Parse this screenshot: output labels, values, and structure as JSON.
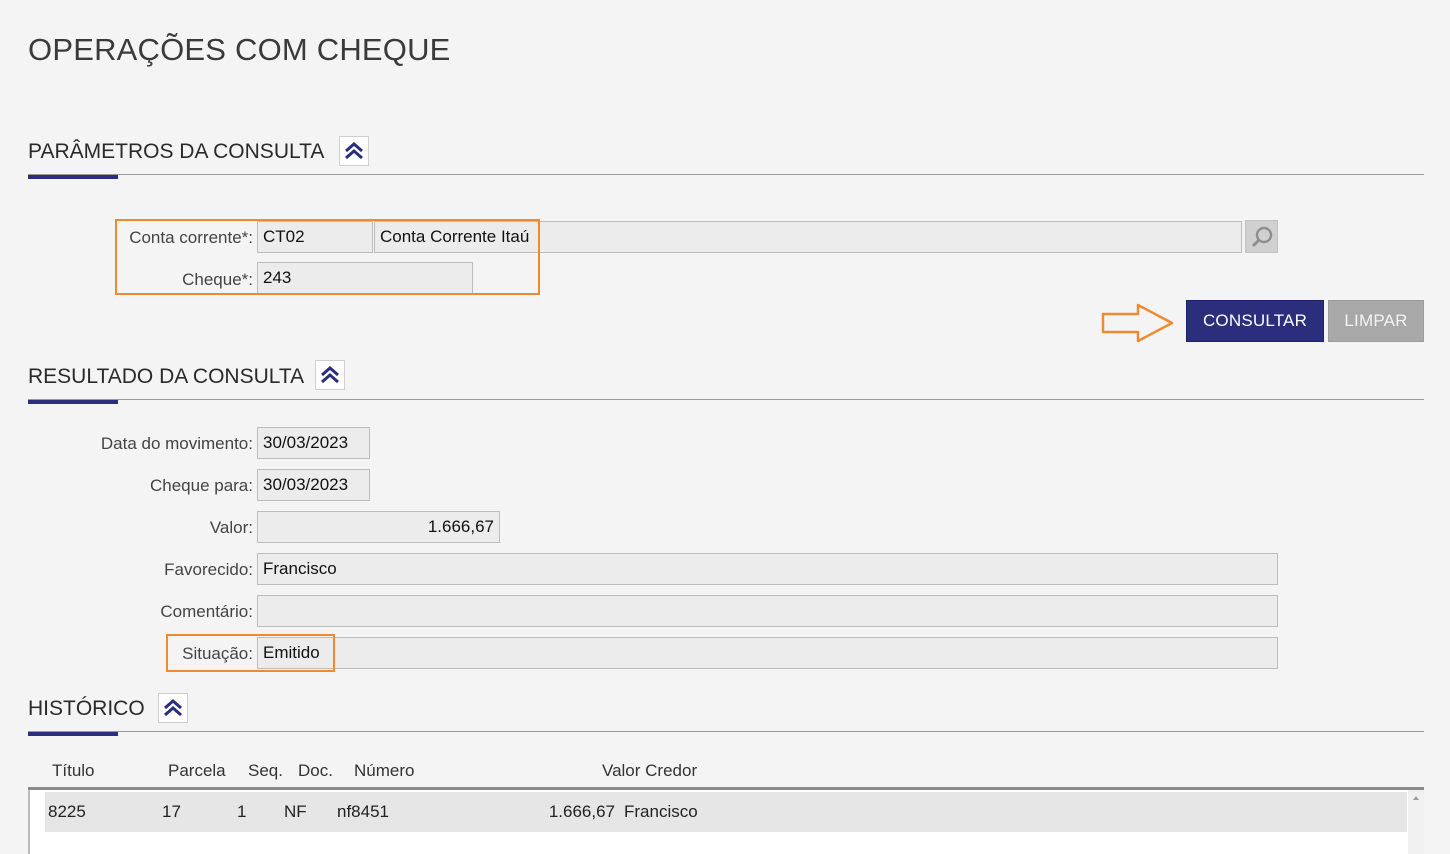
{
  "page": {
    "title": "OPERAÇÕES COM CHEQUE"
  },
  "params": {
    "title": "PARÂMETROS DA CONSULTA",
    "collapse_icon": "double-chevron-up-icon",
    "conta_label": "Conta corrente*:",
    "conta_code": "CT02",
    "conta_name": "Conta Corrente Itaú",
    "search_icon": "magnifier-icon",
    "cheque_label": "Cheque*:",
    "cheque_value": "243",
    "consultar_label": "CONSULTAR",
    "limpar_label": "LIMPAR",
    "arrow_icon": "arrow-right-outline-icon"
  },
  "result": {
    "title": "RESULTADO DA CONSULTA",
    "collapse_icon": "double-chevron-up-icon",
    "fields": {
      "data_movimento": {
        "label": "Data do movimento:",
        "value": "30/03/2023"
      },
      "cheque_para": {
        "label": "Cheque para:",
        "value": "30/03/2023"
      },
      "valor": {
        "label": "Valor:",
        "value": "1.666,67"
      },
      "favorecido": {
        "label": "Favorecido:",
        "value": "Francisco"
      },
      "comentario": {
        "label": "Comentário:",
        "value": ""
      },
      "situacao": {
        "label": "Situação:",
        "value": "Emitido"
      }
    }
  },
  "historico": {
    "title": "HISTÓRICO",
    "collapse_icon": "double-chevron-up-icon",
    "columns": [
      "Título",
      "Parcela",
      "Seq.",
      "Doc.",
      "Número",
      "Valor Credor"
    ],
    "rows": [
      {
        "titulo": "8225",
        "parcela": "17",
        "seq": "1",
        "doc": "NF",
        "numero": "nf8451",
        "valor": "1.666,67",
        "credor": "Francisco"
      }
    ]
  },
  "colors": {
    "accent": "#2a2e7c",
    "highlight": "#f08a30",
    "secondary_button": "#a8a8a8"
  }
}
